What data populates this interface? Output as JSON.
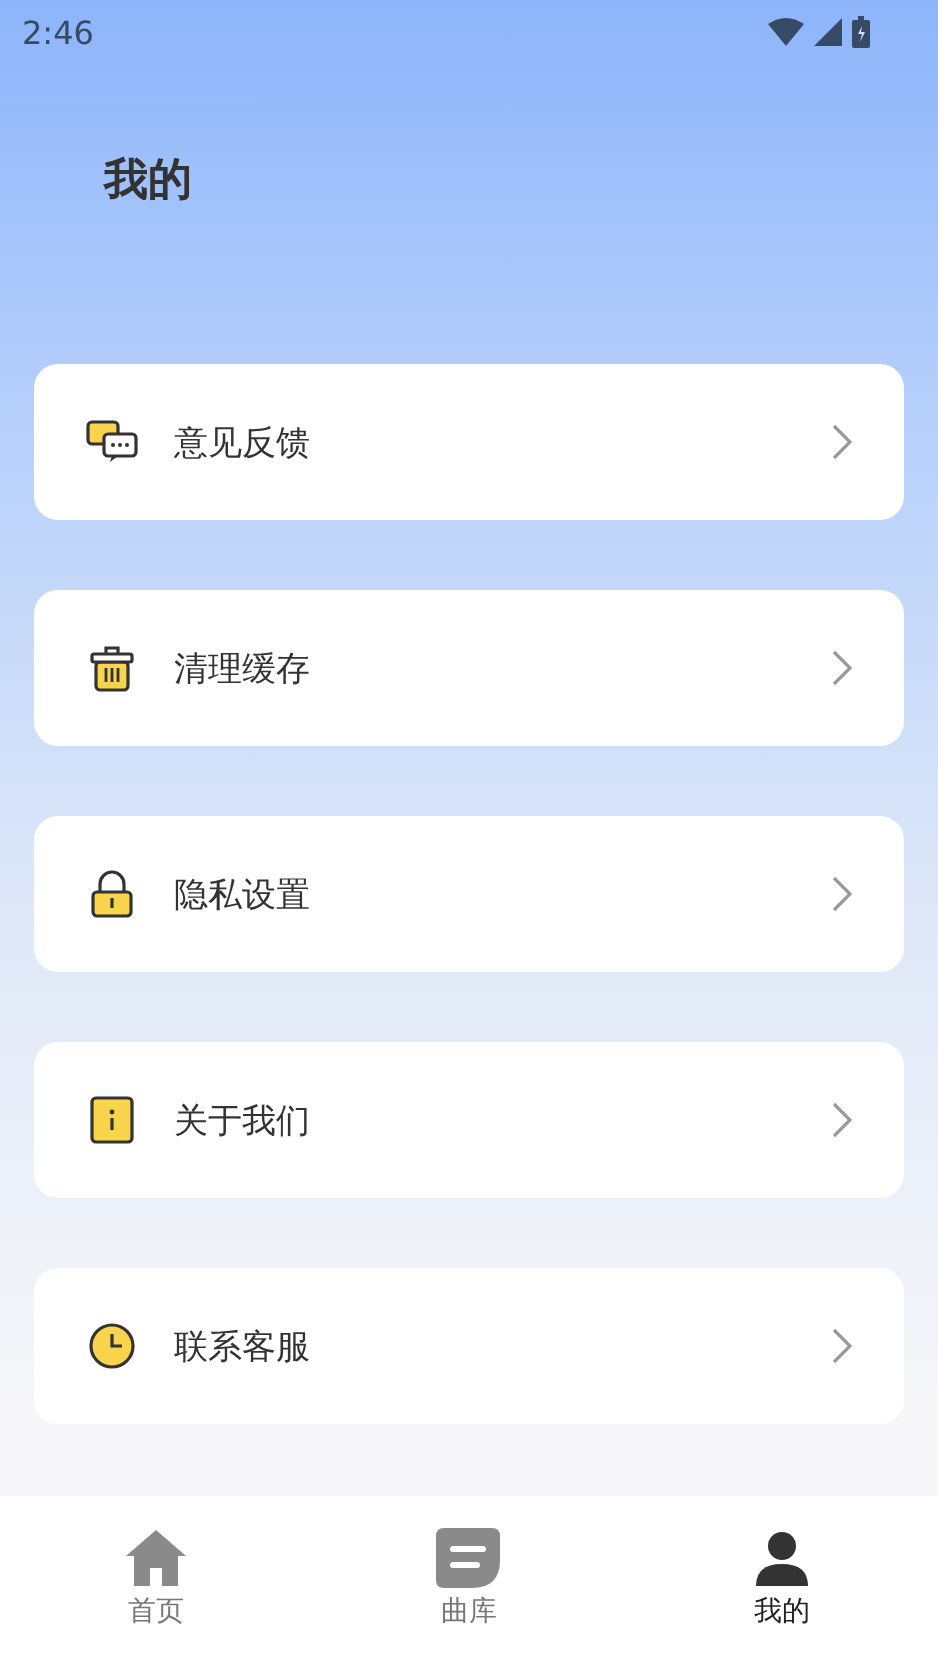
{
  "status_bar": {
    "time": "2:46"
  },
  "title": "我的",
  "menu": [
    {
      "label": "意见反馈"
    },
    {
      "label": "清理缓存"
    },
    {
      "label": "隐私设置"
    },
    {
      "label": "关于我们"
    },
    {
      "label": "联系客服"
    }
  ],
  "tabs": [
    {
      "label": "首页",
      "selected": false
    },
    {
      "label": "曲库",
      "selected": false
    },
    {
      "label": "我的",
      "selected": true
    }
  ]
}
